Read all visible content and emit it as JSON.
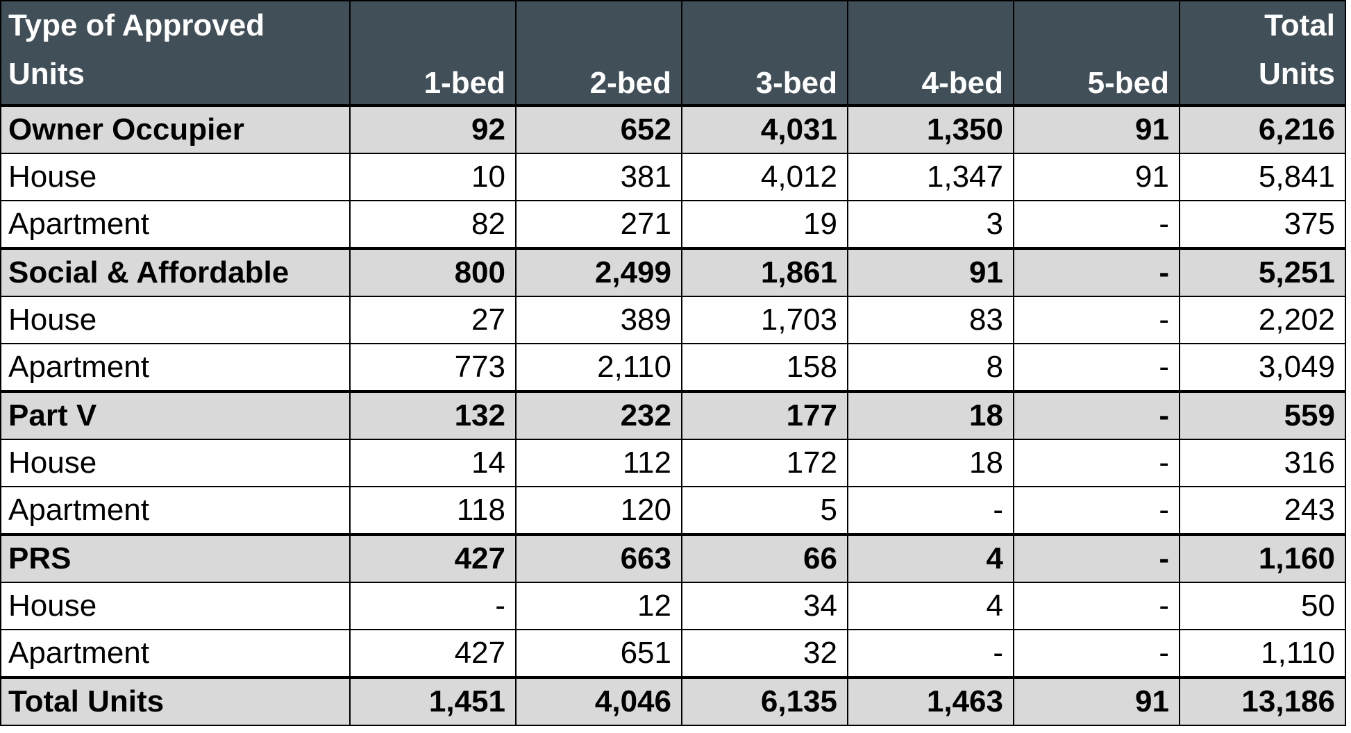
{
  "table": {
    "headers": [
      "Type of Approved Units",
      "1-bed",
      "2-bed",
      "3-bed",
      "4-bed",
      "5-bed",
      "Total Units"
    ],
    "rows": [
      {
        "type": "group",
        "label": "Owner Occupier",
        "values": [
          "92",
          "652",
          "4,031",
          "1,350",
          "91",
          "6,216"
        ]
      },
      {
        "type": "sub",
        "label": "House",
        "values": [
          "10",
          "381",
          "4,012",
          "1,347",
          "91",
          "5,841"
        ]
      },
      {
        "type": "sub",
        "label": "Apartment",
        "values": [
          "82",
          "271",
          "19",
          "3",
          "-",
          "375"
        ]
      },
      {
        "type": "group",
        "label": "Social & Affordable",
        "values": [
          "800",
          "2,499",
          "1,861",
          "91",
          "-",
          "5,251"
        ]
      },
      {
        "type": "sub",
        "label": "House",
        "values": [
          "27",
          "389",
          "1,703",
          "83",
          "-",
          "2,202"
        ]
      },
      {
        "type": "sub",
        "label": "Apartment",
        "values": [
          "773",
          "2,110",
          "158",
          "8",
          "-",
          "3,049"
        ]
      },
      {
        "type": "group",
        "label": "Part V",
        "values": [
          "132",
          "232",
          "177",
          "18",
          "-",
          "559"
        ]
      },
      {
        "type": "sub",
        "label": "House",
        "values": [
          "14",
          "112",
          "172",
          "18",
          "-",
          "316"
        ]
      },
      {
        "type": "sub",
        "label": "Apartment",
        "values": [
          "118",
          "120",
          "5",
          "-",
          "-",
          "243"
        ]
      },
      {
        "type": "group",
        "label": "PRS",
        "values": [
          "427",
          "663",
          "66",
          "4",
          "-",
          "1,160"
        ]
      },
      {
        "type": "sub",
        "label": "House",
        "values": [
          "-",
          "12",
          "34",
          "4",
          "-",
          "50"
        ]
      },
      {
        "type": "sub",
        "label": "Apartment",
        "values": [
          "427",
          "651",
          "32",
          "-",
          "-",
          "1,110"
        ]
      },
      {
        "type": "total",
        "label": "Total Units",
        "values": [
          "1,451",
          "4,046",
          "6,135",
          "1,463",
          "91",
          "13,186"
        ]
      }
    ]
  }
}
